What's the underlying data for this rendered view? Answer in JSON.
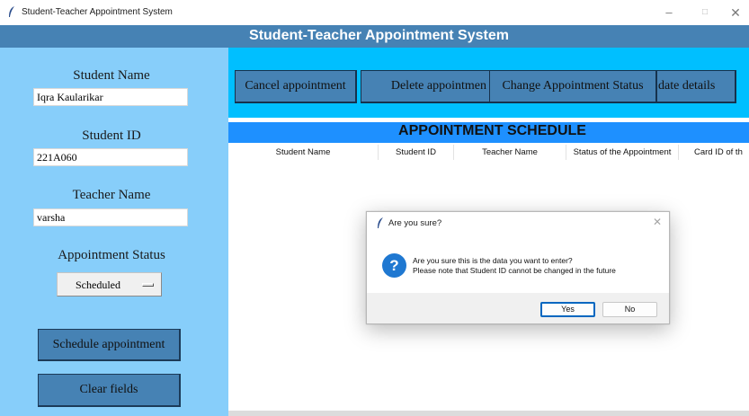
{
  "window": {
    "title": "Student-Teacher Appointment System",
    "controls": {
      "minimize": "–",
      "maximize": "□",
      "close": "✕"
    }
  },
  "header": {
    "title": "Student-Teacher Appointment System"
  },
  "form": {
    "student_name": {
      "label": "Student Name",
      "value": "Iqra Kaularikar"
    },
    "student_id": {
      "label": "Student ID",
      "value": "221A060"
    },
    "teacher_name": {
      "label": "Teacher Name",
      "value": "varsha"
    },
    "appointment_status": {
      "label": "Appointment Status",
      "value": "Scheduled"
    },
    "schedule_button": "Schedule appointment",
    "clear_button": "Clear fields"
  },
  "toolbar": {
    "cancel": "Cancel appointment",
    "delete": "Delete appointmen",
    "change_status": "Change Appointment Status",
    "update_details": "date details"
  },
  "schedule": {
    "title": "APPOINTMENT SCHEDULE",
    "columns": [
      "Student Name",
      "Student ID",
      "Teacher Name",
      "Status of the Appointment",
      "Card ID of th"
    ]
  },
  "dialog": {
    "title": "Are you sure?",
    "close": "✕",
    "icon": "?",
    "message_line1": "Are you sure this is the data you want to enter?",
    "message_line2": "Please note that Student ID cannot be changed in the future",
    "yes": "Yes",
    "no": "No"
  },
  "colors": {
    "header": "#4682b4",
    "left_panel": "#87cefa",
    "button_bar": "#00bfff",
    "schedule_header": "#1e90ff",
    "dialog_accent": "#0067c0"
  }
}
